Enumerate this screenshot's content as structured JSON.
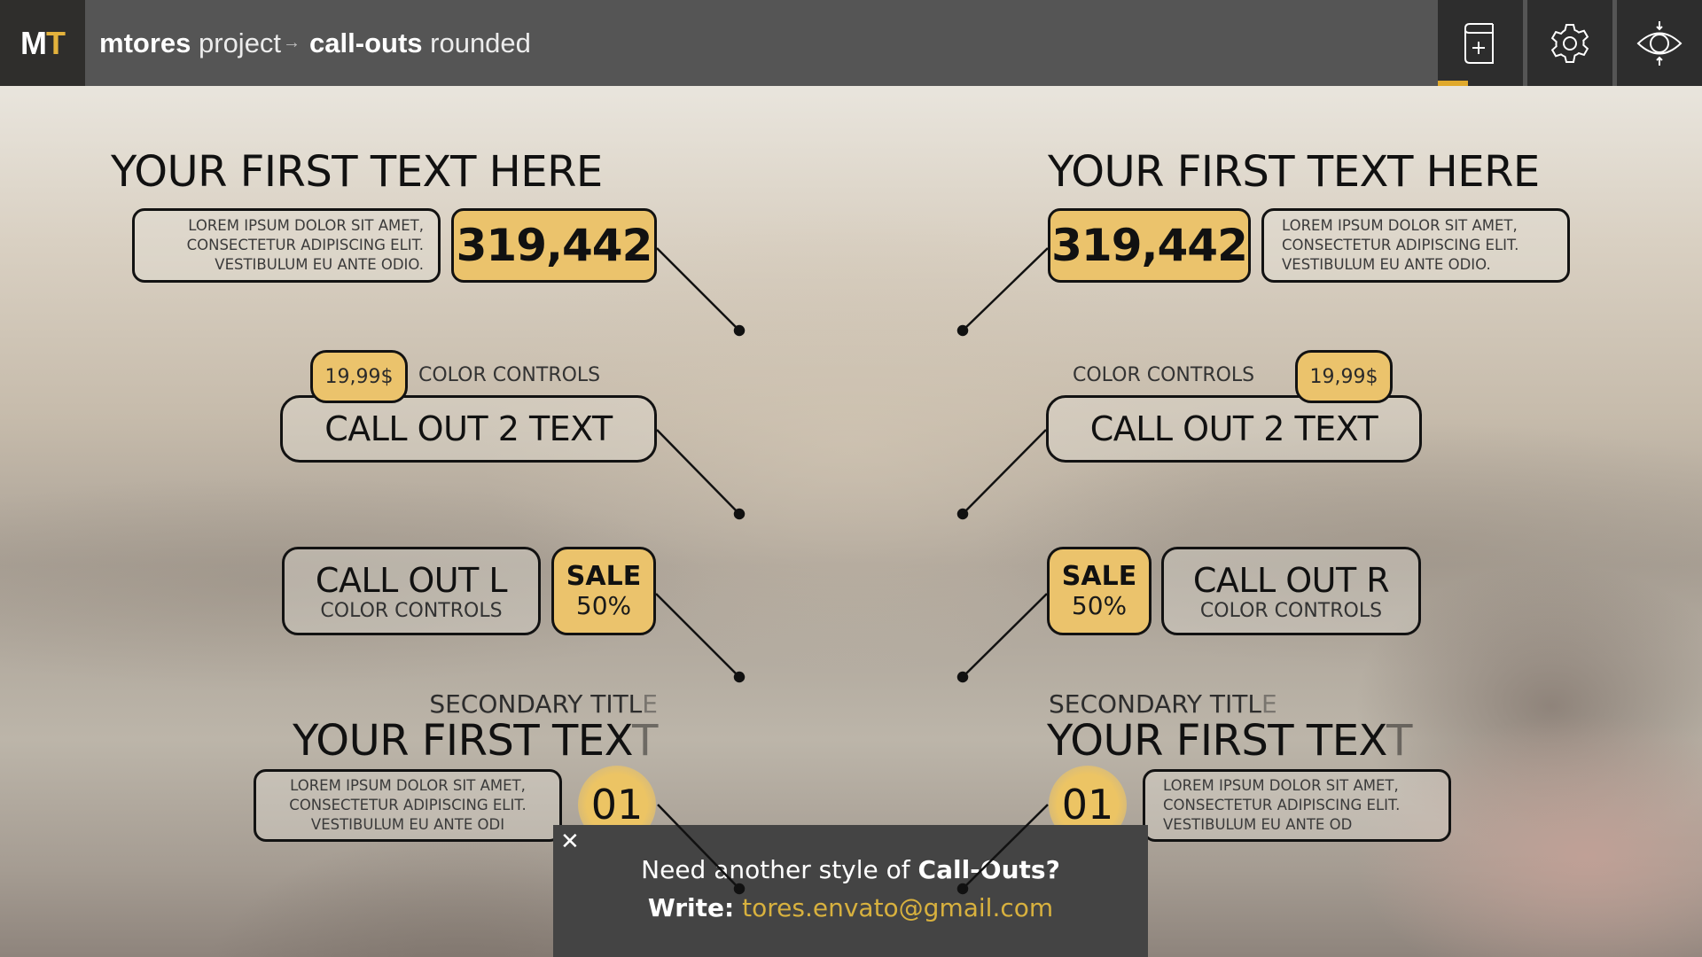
{
  "header": {
    "logo": {
      "first": "M",
      "second": "T"
    },
    "title": {
      "project_bold": "mtores",
      "project_light": "project",
      "separator": "→",
      "page_bold": "call-outs",
      "page_light": "rounded"
    },
    "buttons": [
      {
        "name": "add-to-library",
        "icon": "book-plus-icon",
        "active": true
      },
      {
        "name": "settings",
        "icon": "gear-icon",
        "active": false
      },
      {
        "name": "preview",
        "icon": "eye-focus-icon",
        "active": false
      }
    ]
  },
  "colors": {
    "accent": "#e0a92b",
    "gold_box": "#ebc36c",
    "header_bg": "#555555",
    "logo_bg": "#2f2e2c",
    "popup_bg": "#444444",
    "email": "#d8b13e"
  },
  "left": {
    "c1": {
      "heading": "YOUR FIRST TEXT HERE",
      "lorem": [
        "LOREM IPSUM DOLOR SIT AMET,",
        "CONSECTETUR ADIPISCING ELIT.",
        "VESTIBULUM EU ANTE ODIO."
      ],
      "number": "319,442"
    },
    "c2": {
      "price": "19,99$",
      "caption": "COLOR CONTROLS",
      "text": "CALL OUT 2 TEXT"
    },
    "c3": {
      "title": "CALL OUT L",
      "caption": "COLOR CONTROLS",
      "sale": "SALE",
      "percent": "50%"
    },
    "c4": {
      "secondary": "SECONDARY TITL",
      "secondary_fade": "E",
      "heading": "YOUR FIRST TEX",
      "heading_fade": "T",
      "lorem": [
        "LOREM IPSUM DOLOR SIT AMET,",
        "CONSECTETUR ADIPISCING ELIT.",
        "VESTIBULUM EU ANTE ODI"
      ],
      "badge": "01"
    }
  },
  "right": {
    "c1": {
      "heading": "YOUR FIRST TEXT HERE",
      "lorem": [
        "LOREM IPSUM DOLOR SIT AMET,",
        "CONSECTETUR ADIPISCING ELIT.",
        "VESTIBULUM EU ANTE ODIO."
      ],
      "number": "319,442"
    },
    "c2": {
      "price": "19,99$",
      "caption": "COLOR CONTROLS",
      "text": "CALL OUT 2 TEXT"
    },
    "c3": {
      "title": "CALL OUT R",
      "caption": "COLOR CONTROLS",
      "sale": "SALE",
      "percent": "50%"
    },
    "c4": {
      "secondary": "SECONDARY TITL",
      "secondary_fade": "E",
      "heading": "YOUR FIRST TEX",
      "heading_fade": "T",
      "lorem": [
        "LOREM IPSUM DOLOR SIT AMET,",
        "CONSECTETUR ADIPISCING ELIT.",
        "VESTIBULUM EU ANTE OD"
      ],
      "badge": "01"
    }
  },
  "popup": {
    "close": "✕",
    "line1_text": "Need another style of ",
    "line1_bold": "Call-Outs?",
    "line2_bold": "Write:",
    "email": "tores.envato@gmail.com"
  }
}
